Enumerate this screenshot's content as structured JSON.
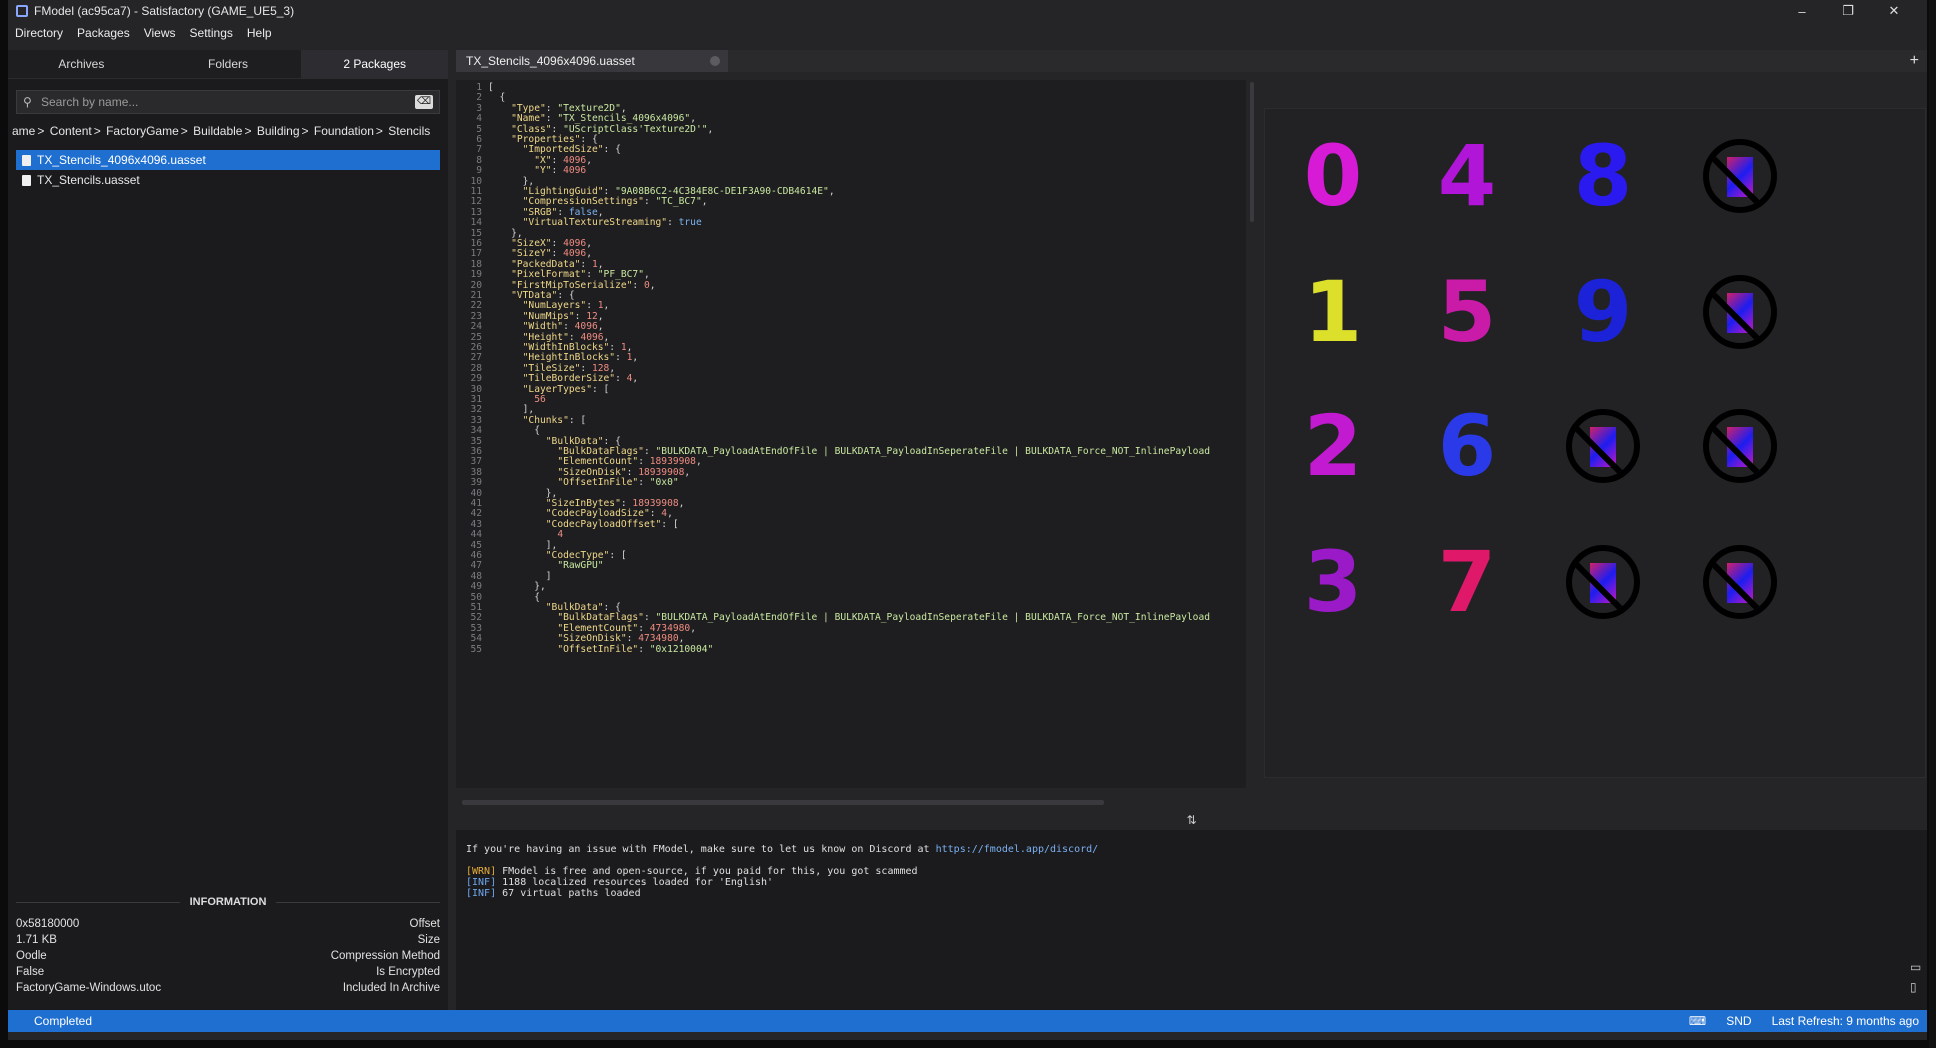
{
  "window": {
    "title": "FModel (ac95ca7) - Satisfactory (GAME_UE5_3)",
    "minimize": "–",
    "maximize": "❐",
    "close": "✕"
  },
  "menu": [
    "Directory",
    "Packages",
    "Views",
    "Settings",
    "Help"
  ],
  "left_tabs": [
    "Archives",
    "Folders",
    "2 Packages"
  ],
  "search": {
    "placeholder": "Search by name...",
    "clear": "⌫"
  },
  "breadcrumb": [
    "ame",
    "Content",
    "FactoryGame",
    "Buildable",
    "Building",
    "Foundation",
    "Stencils"
  ],
  "files": [
    "TX_Stencils_4096x4096.uasset",
    "TX_Stencils.uasset"
  ],
  "information": {
    "title": "INFORMATION",
    "rows": [
      {
        "value": "0x58180000",
        "label": "Offset"
      },
      {
        "value": "1.71 KB",
        "label": "Size"
      },
      {
        "value": "Oodle",
        "label": "Compression Method"
      },
      {
        "value": "False",
        "label": "Is Encrypted"
      },
      {
        "value": "FactoryGame-Windows.utoc",
        "label": "Included In Archive"
      }
    ]
  },
  "document_tab": {
    "label": "TX_Stencils_4096x4096.uasset",
    "add": "+"
  },
  "code_lines": [
    "[",
    "  {",
    "    \"Type\": \"Texture2D\",",
    "    \"Name\": \"TX_Stencils_4096x4096\",",
    "    \"Class\": \"UScriptClass'Texture2D'\",",
    "    \"Properties\": {",
    "      \"ImportedSize\": {",
    "        \"X\": 4096,",
    "        \"Y\": 4096",
    "      },",
    "      \"LightingGuid\": \"9A08B6C2-4C384E8C-DE1F3A90-CDB4614E\",",
    "      \"CompressionSettings\": \"TC_BC7\",",
    "      \"SRGB\": false,",
    "      \"VirtualTextureStreaming\": true",
    "    },",
    "    \"SizeX\": 4096,",
    "    \"SizeY\": 4096,",
    "    \"PackedData\": 1,",
    "    \"PixelFormat\": \"PF_BC7\",",
    "    \"FirstMipToSerialize\": 0,",
    "    \"VTData\": {",
    "      \"NumLayers\": 1,",
    "      \"NumMips\": 12,",
    "      \"Width\": 4096,",
    "      \"Height\": 4096,",
    "      \"WidthInBlocks\": 1,",
    "      \"HeightInBlocks\": 1,",
    "      \"TileSize\": 128,",
    "      \"TileBorderSize\": 4,",
    "      \"LayerTypes\": [",
    "        56",
    "      ],",
    "      \"Chunks\": [",
    "        {",
    "          \"BulkData\": {",
    "            \"BulkDataFlags\": \"BULKDATA_PayloadAtEndOfFile | BULKDATA_PayloadInSeperateFile | BULKDATA_Force_NOT_InlinePayload",
    "            \"ElementCount\": 18939908,",
    "            \"SizeOnDisk\": 18939908,",
    "            \"OffsetInFile\": \"0x0\"",
    "          },",
    "          \"SizeInBytes\": 18939908,",
    "          \"CodecPayloadSize\": 4,",
    "          \"CodecPayloadOffset\": [",
    "            4",
    "          ],",
    "          \"CodecType\": [",
    "            \"RawGPU\"",
    "          ]",
    "        },",
    "        {",
    "          \"BulkData\": {",
    "            \"BulkDataFlags\": \"BULKDATA_PayloadAtEndOfFile | BULKDATA_PayloadInSeperateFile | BULKDATA_Force_NOT_InlinePayload",
    "            \"ElementCount\": 4734980,",
    "            \"SizeOnDisk\": 4734980,",
    "            \"OffsetInFile\": \"0x1210004\""
  ],
  "texture_glyphs": [
    "0",
    "4",
    "8",
    "1",
    "5",
    "9",
    "2",
    "6",
    "3",
    "7"
  ],
  "splitter": "⇅",
  "console": {
    "intro": "If you're having an issue with FModel, make sure to let us know on Discord at ",
    "link": "https://fmodel.app/discord/",
    "logs": [
      {
        "tag": "[WRN]",
        "text": " FModel is free and open-source, if you paid for this, you got scammed"
      },
      {
        "tag": "[INF]",
        "text": " 1188 localized resources loaded for 'English'"
      },
      {
        "tag": "[INF]",
        "text": " 67 virtual paths loaded"
      }
    ]
  },
  "status": {
    "left": "Completed",
    "snd": "SND",
    "refresh": "Last Refresh: 9 months ago"
  },
  "colors": {
    "accent": "#1f6fd1",
    "key": "#f0d889",
    "string": "#c9e8a0",
    "number": "#f08c80",
    "bool": "#7cb4f0"
  }
}
